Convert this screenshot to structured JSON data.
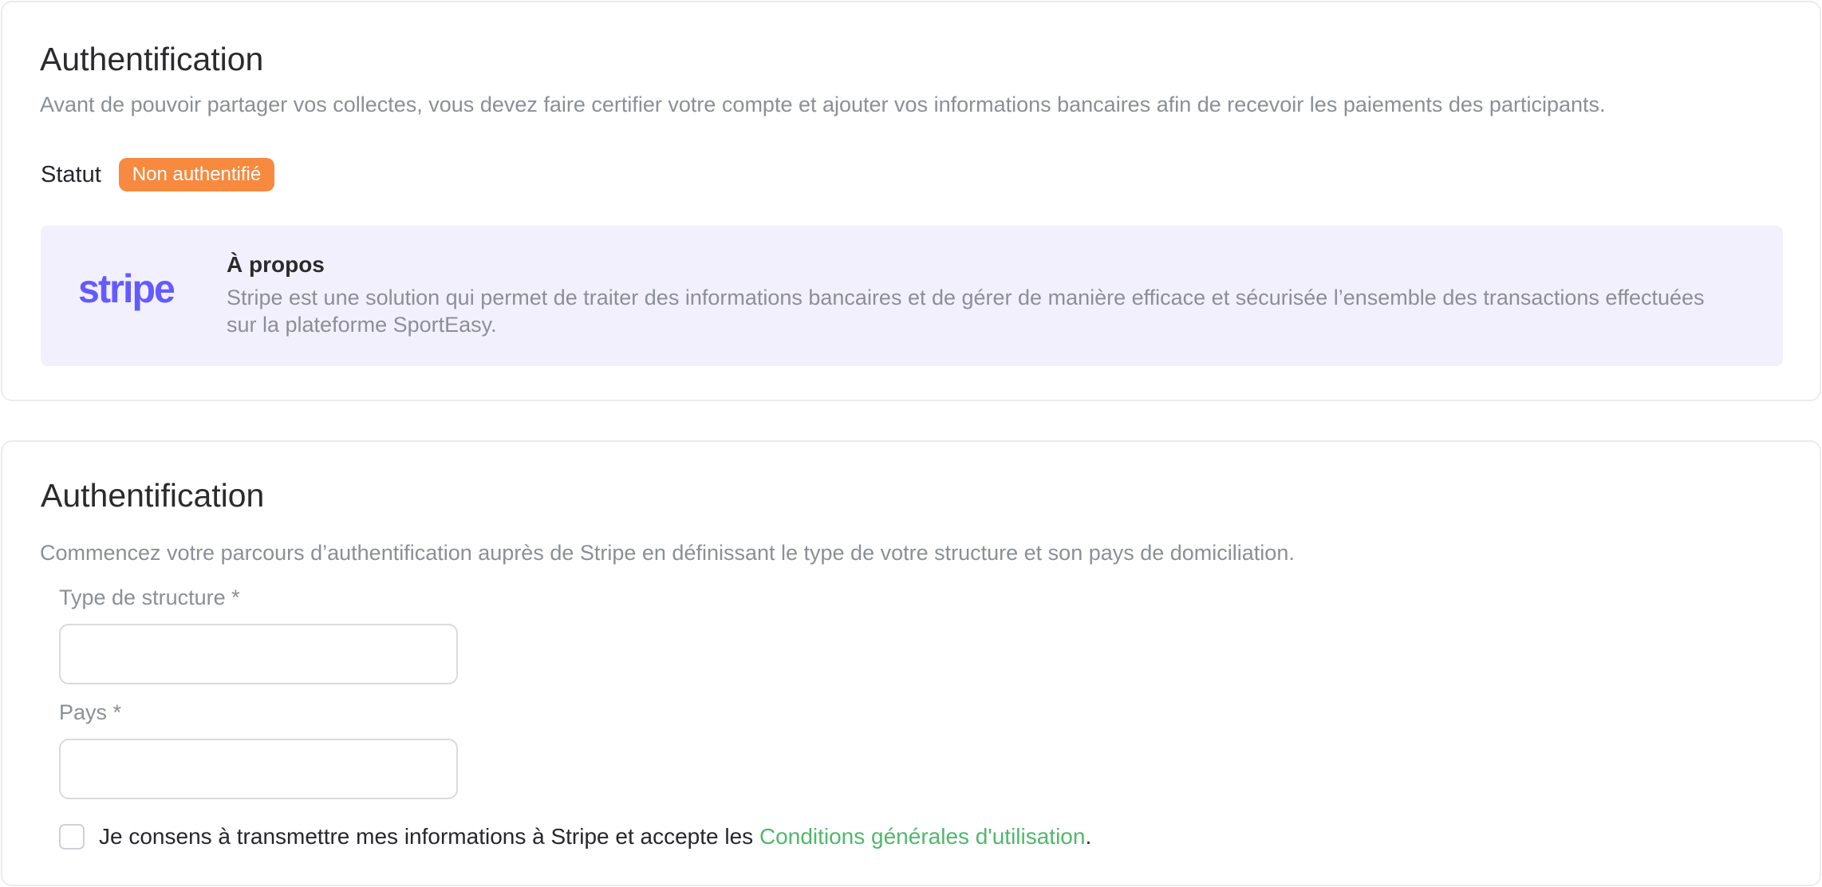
{
  "overview": {
    "title": "Authentification",
    "description": "Avant de pouvoir partager vos collectes, vous devez faire certifier votre compte et ajouter vos informations bancaires afin de recevoir les paiements des participants.",
    "status_label": "Statut",
    "status_badge": "Non authentifié",
    "status_color": "#f78a3e",
    "about": {
      "logo_text": "stripe",
      "logo_color": "#635bff",
      "title": "À propos",
      "text": "Stripe est une solution qui permet de traiter des informations bancaires et de gérer de manière efficace et sécurisée l’ensemble des transactions effectuées sur la plateforme SportEasy."
    }
  },
  "form": {
    "title": "Authentification",
    "description": "Commencez votre parcours d’authentification auprès de Stripe en définissant le type de votre structure et son pays de domiciliation.",
    "structure_type": {
      "label": "Type de structure *",
      "value": ""
    },
    "country": {
      "label": "Pays *",
      "value": ""
    },
    "consent": {
      "checked": false,
      "text_before": "Je consens à transmettre mes informations à Stripe et accepte les ",
      "link_text": "Conditions générales d'utilisation",
      "text_after": "."
    },
    "link_color": "#4fb86b"
  }
}
